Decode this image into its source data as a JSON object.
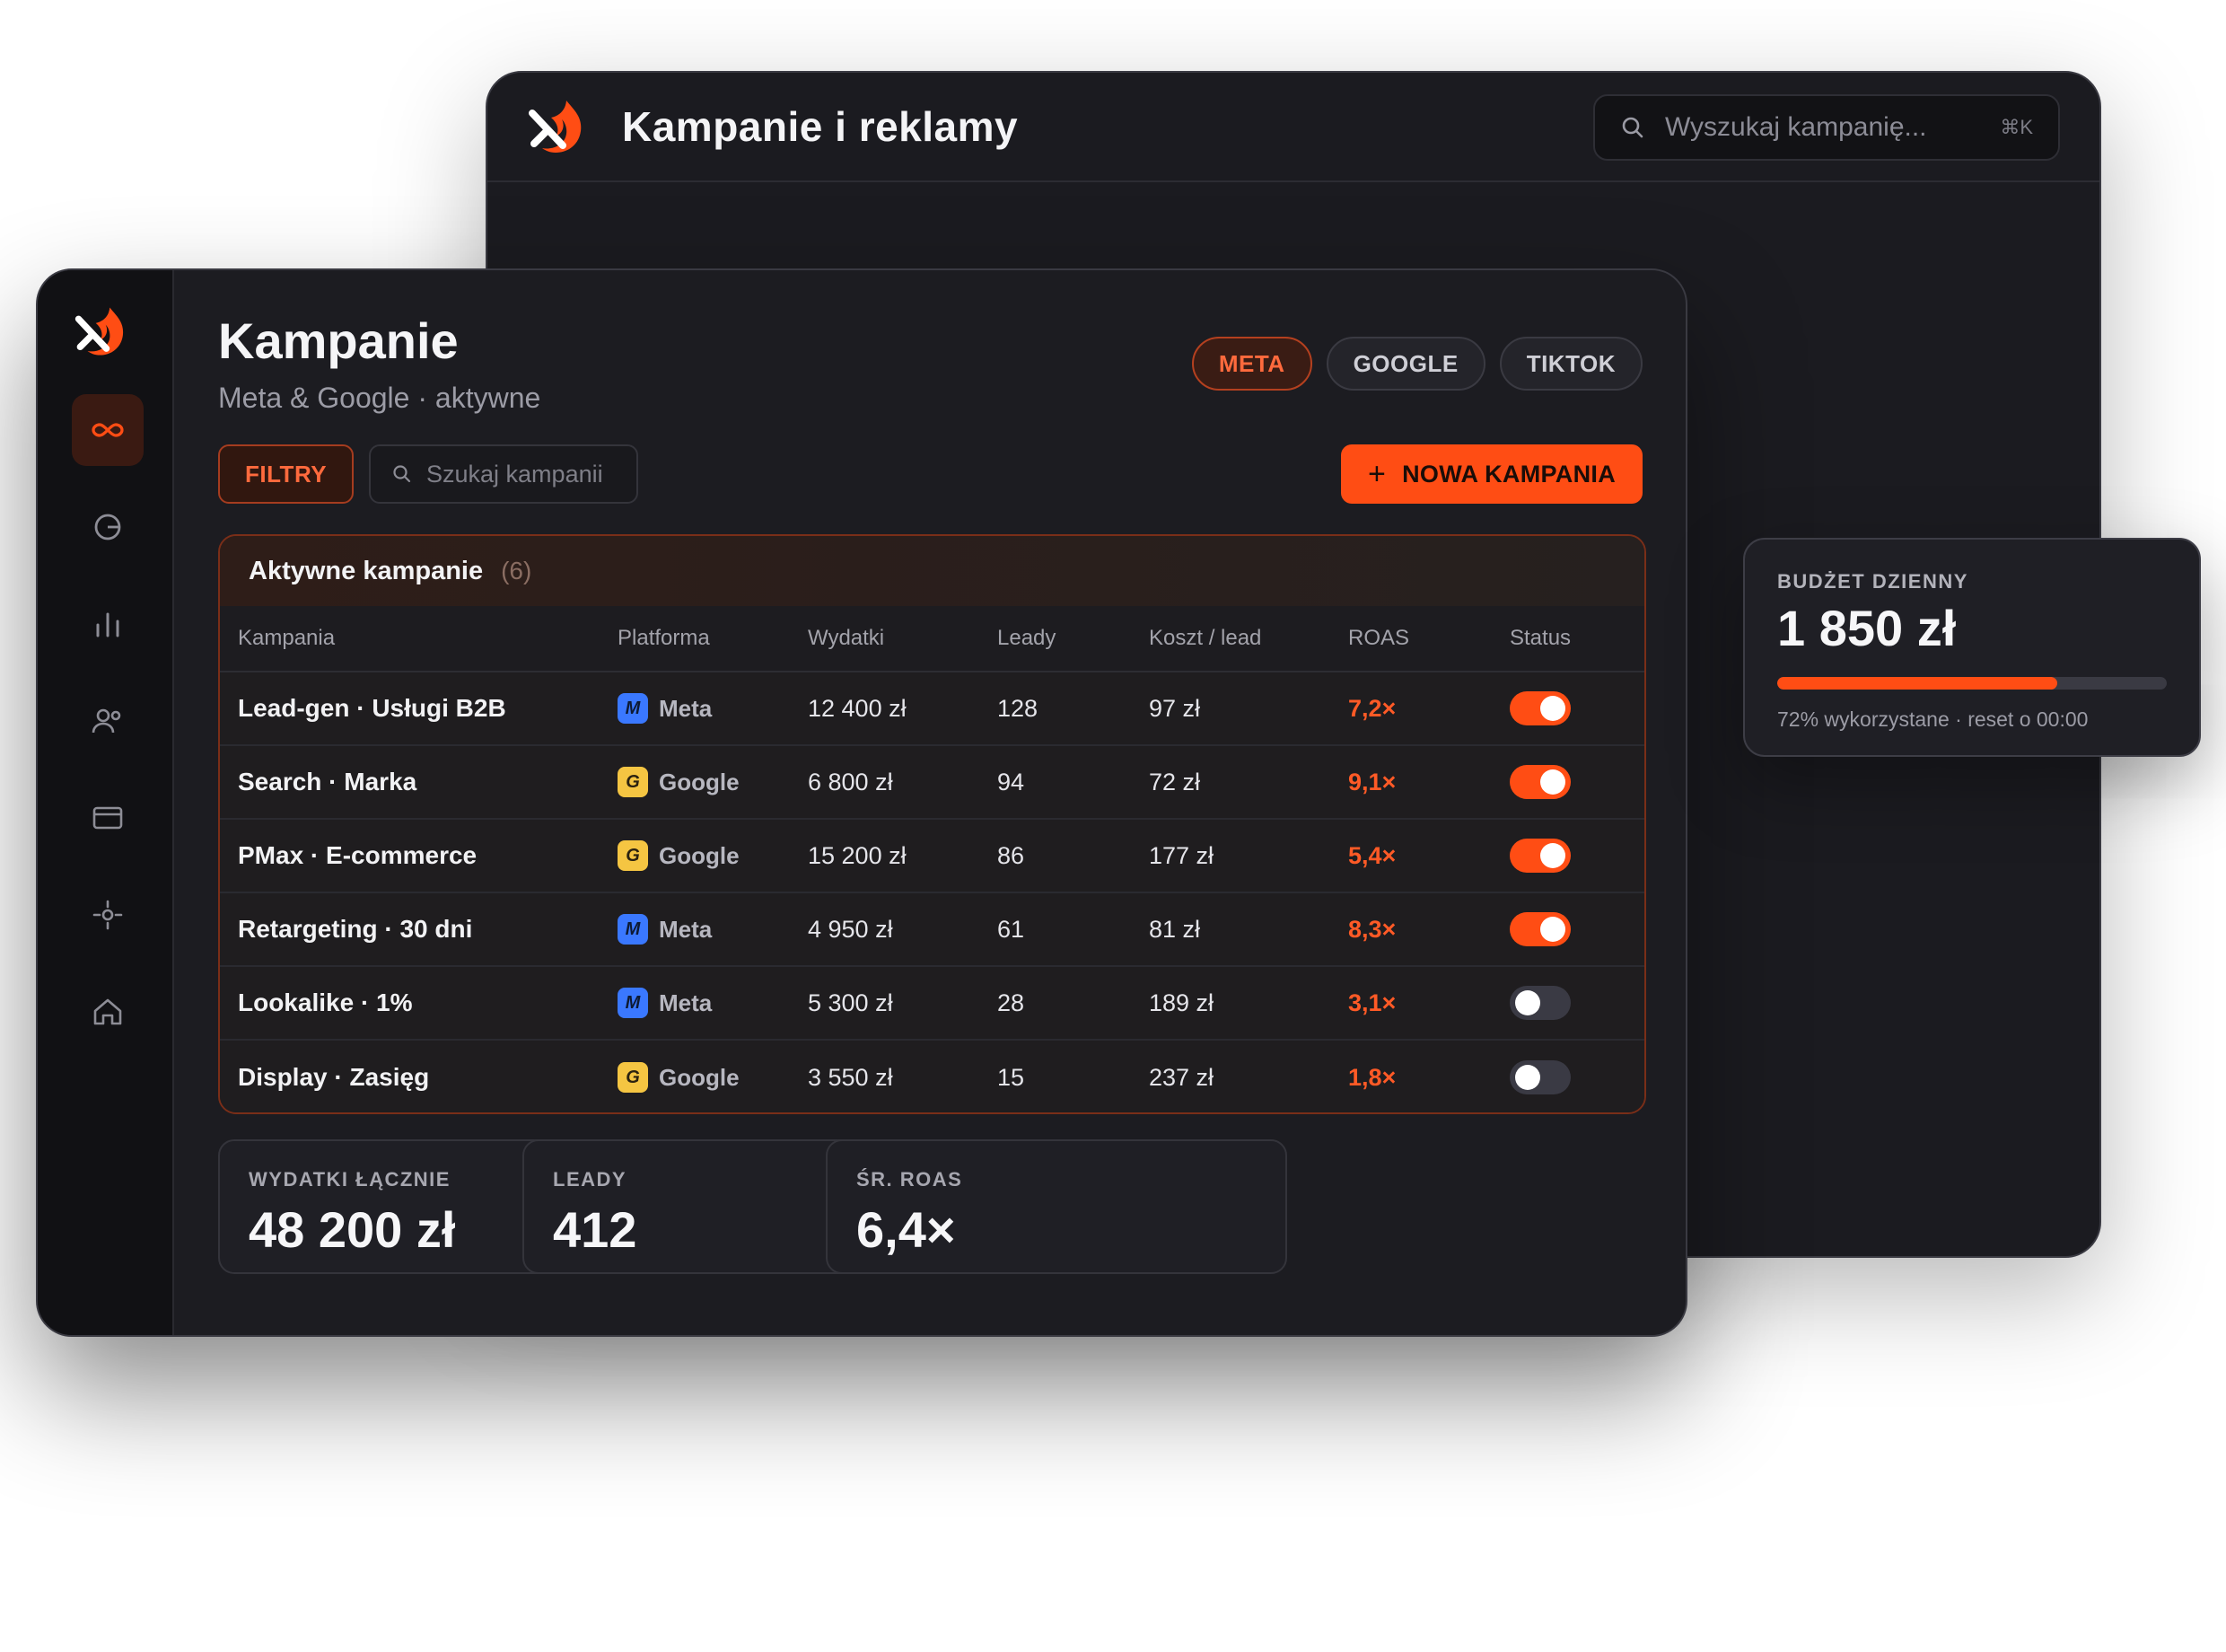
{
  "back_window": {
    "title": "Kampanie i reklamy",
    "search_placeholder": "Wyszukaj kampanię...",
    "shortcut": "⌘K"
  },
  "sidebar": {
    "items": [
      {
        "icon": "infinity-icon",
        "active": true
      },
      {
        "icon": "pie-chart-icon",
        "active": false
      },
      {
        "icon": "bar-chart-icon",
        "active": false
      },
      {
        "icon": "users-icon",
        "active": false
      },
      {
        "icon": "credit-card-icon",
        "active": false
      },
      {
        "icon": "settings-icon",
        "active": false
      },
      {
        "icon": "home-icon",
        "active": false
      }
    ]
  },
  "header": {
    "title": "Kampanie",
    "subtitle": "Meta & Google · aktywne"
  },
  "tabs": [
    {
      "label": "META",
      "active": true
    },
    {
      "label": "GOOGLE",
      "active": false
    },
    {
      "label": "TIKTOK",
      "active": false
    }
  ],
  "toolbar": {
    "filters_label": "FILTRY",
    "search_placeholder": "Szukaj kampanii",
    "new_campaign_label": "NOWA KAMPANIA"
  },
  "table": {
    "title": "Aktywne kampanie",
    "count": "(6)",
    "columns": [
      "Kampania",
      "Platforma",
      "Wydatki",
      "Leady",
      "Koszt / lead",
      "ROAS",
      "Status"
    ],
    "rows": [
      {
        "name": "Lead-gen · Usługi B2B",
        "platform": "Meta",
        "badge": "M",
        "spend": "12 400 zł",
        "leads": "128",
        "cpl": "97 zł",
        "roas": "7,2×",
        "active": true
      },
      {
        "name": "Search · Marka",
        "platform": "Google",
        "badge": "G",
        "spend": "6 800 zł",
        "leads": "94",
        "cpl": "72 zł",
        "roas": "9,1×",
        "active": true
      },
      {
        "name": "PMax · E-commerce",
        "platform": "Google",
        "badge": "G",
        "spend": "15 200 zł",
        "leads": "86",
        "cpl": "177 zł",
        "roas": "5,4×",
        "active": true
      },
      {
        "name": "Retargeting · 30 dni",
        "platform": "Meta",
        "badge": "M",
        "spend": "4 950 zł",
        "leads": "61",
        "cpl": "81 zł",
        "roas": "8,3×",
        "active": true
      },
      {
        "name": "Lookalike · 1%",
        "platform": "Meta",
        "badge": "M",
        "spend": "5 300 zł",
        "leads": "28",
        "cpl": "189 zł",
        "roas": "3,1×",
        "active": false
      },
      {
        "name": "Display · Zasięg",
        "platform": "Google",
        "badge": "G",
        "spend": "3 550 zł",
        "leads": "15",
        "cpl": "237 zł",
        "roas": "1,8×",
        "active": false
      }
    ]
  },
  "stats": [
    {
      "label": "WYDATKI ŁĄCZNIE",
      "value": "48 200 zł"
    },
    {
      "label": "LEADY",
      "value": "412"
    },
    {
      "label": "ŚR. ROAS",
      "value": "6,4×"
    }
  ],
  "budget": {
    "label": "BUDŻET DZIENNY",
    "value": "1 850 zł",
    "used_fraction": 0.72,
    "note": "72% wykorzystane · reset o 00:00"
  },
  "colors": {
    "accent": "#ff4d14",
    "meta_badge": "#3a78ff",
    "google_badge": "#f5c542",
    "background_dark": "#1c1c21"
  }
}
